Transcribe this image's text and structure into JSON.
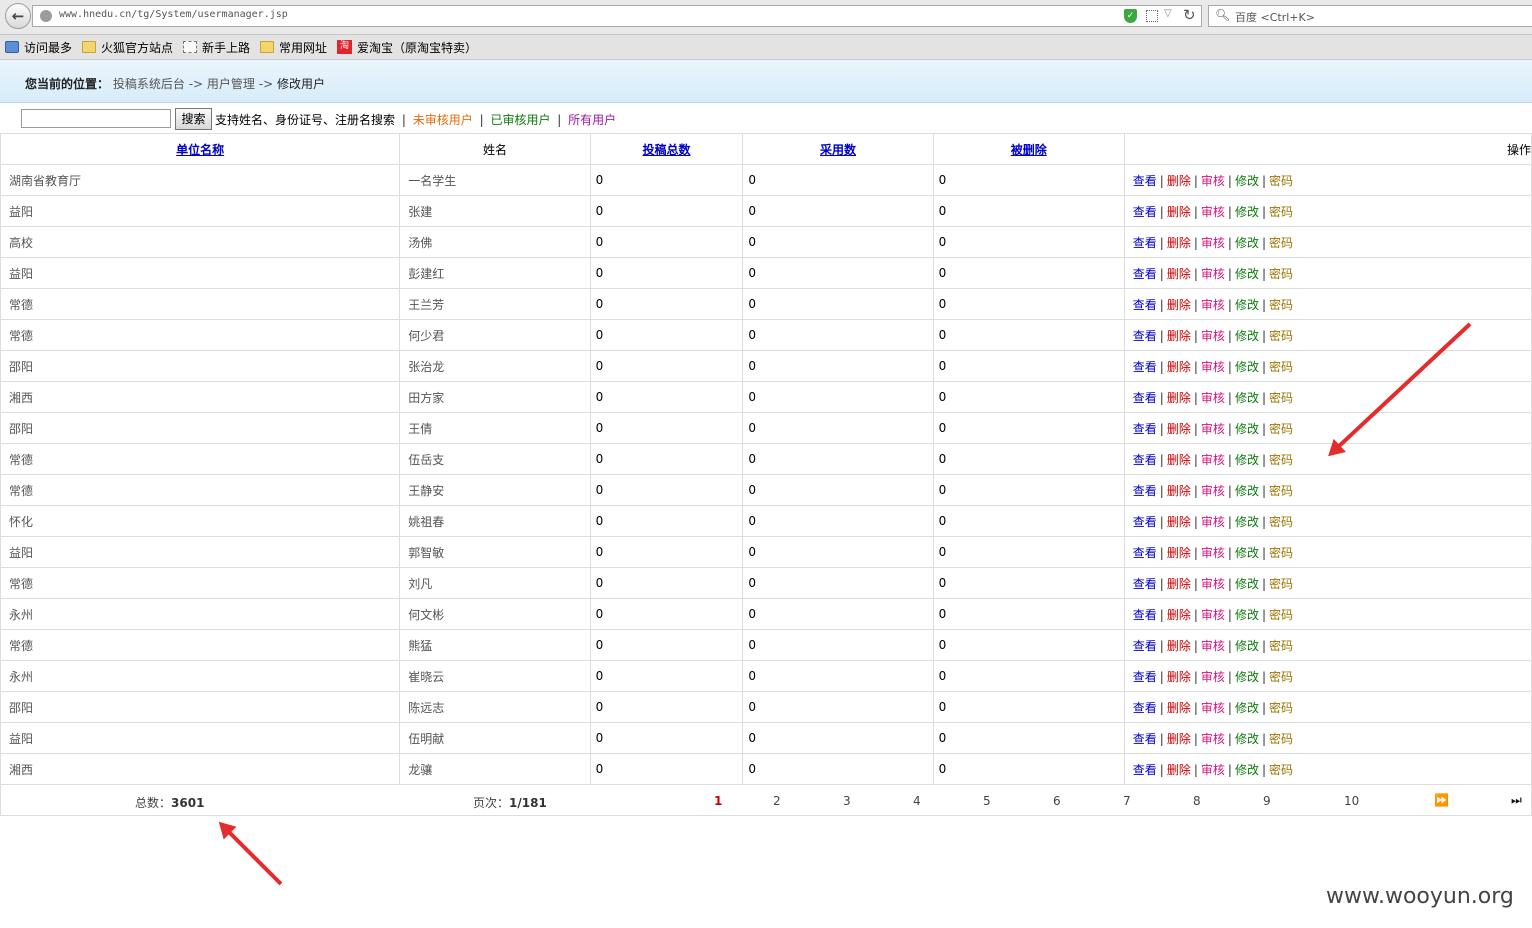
{
  "browser": {
    "url": "www.hnedu.cn/tg/System/usermanager.jsp",
    "search_placeholder": "百度 <Ctrl+K>",
    "bookmarks": [
      {
        "label": "访问最多",
        "icon": "visited-icon"
      },
      {
        "label": "火狐官方站点",
        "icon": "folder-icon"
      },
      {
        "label": "新手上路",
        "icon": "page-icon"
      },
      {
        "label": "常用网址",
        "icon": "folder-icon"
      },
      {
        "label": "爱淘宝（原淘宝特卖）",
        "icon": "taobao-icon",
        "icon_text": "淘"
      }
    ]
  },
  "breadcrumb": {
    "label": "您当前的位置：",
    "items": [
      "投稿系统后台",
      "用户管理",
      "修改用户"
    ],
    "separator": "->"
  },
  "search": {
    "button": "搜索",
    "hint": "支持姓名、身份证号、注册名搜索",
    "filter_unreviewed": "未审核用户",
    "filter_reviewed": "已审核用户",
    "filter_all": "所有用户"
  },
  "table": {
    "headers": [
      "单位名称",
      "姓名",
      "投稿总数",
      "采用数",
      "被删除",
      "操作"
    ],
    "actions": [
      "查看",
      "删除",
      "审核",
      "修改",
      "密码"
    ],
    "rows": [
      [
        "湖南省教育厅",
        "一名学生",
        "0",
        "0",
        "0"
      ],
      [
        "益阳",
        "张建",
        "0",
        "0",
        "0"
      ],
      [
        "高校",
        "汤佛",
        "0",
        "0",
        "0"
      ],
      [
        "益阳",
        "彭建红",
        "0",
        "0",
        "0"
      ],
      [
        "常德",
        "王兰芳",
        "0",
        "0",
        "0"
      ],
      [
        "常德",
        "何少君",
        "0",
        "0",
        "0"
      ],
      [
        "邵阳",
        "张治龙",
        "0",
        "0",
        "0"
      ],
      [
        "湘西",
        "田方家",
        "0",
        "0",
        "0"
      ],
      [
        "邵阳",
        "王倩",
        "0",
        "0",
        "0"
      ],
      [
        "常德",
        "伍岳支",
        "0",
        "0",
        "0"
      ],
      [
        "常德",
        "王静安",
        "0",
        "0",
        "0"
      ],
      [
        "怀化",
        "姚祖春",
        "0",
        "0",
        "0"
      ],
      [
        "益阳",
        "郭智敏",
        "0",
        "0",
        "0"
      ],
      [
        "常德",
        "刘凡",
        "0",
        "0",
        "0"
      ],
      [
        "永州",
        "何文彬",
        "0",
        "0",
        "0"
      ],
      [
        "常德",
        "熊猛",
        "0",
        "0",
        "0"
      ],
      [
        "永州",
        "崔晓云",
        "0",
        "0",
        "0"
      ],
      [
        "邵阳",
        "陈远志",
        "0",
        "0",
        "0"
      ],
      [
        "益阳",
        "伍明献",
        "0",
        "0",
        "0"
      ],
      [
        "湘西",
        "龙骧",
        "0",
        "0",
        "0"
      ]
    ]
  },
  "pagination": {
    "total_label": "总数：",
    "total": "3601",
    "page_label": "页次：",
    "page": "1/181",
    "current": "1",
    "pages": [
      "1",
      "2",
      "3",
      "4",
      "5",
      "6",
      "7",
      "8",
      "9",
      "10"
    ],
    "next_glyph": "⏩",
    "last_glyph": "⏭"
  },
  "watermark": "www.wooyun.org",
  "colors": {
    "annotation_arrow": "#e42c2c",
    "link_blue": "#0000cc",
    "delete_red": "#cc0000",
    "audit_pink": "#d6137f",
    "edit_green": "#0d7a0d",
    "password_gold": "#9a7300"
  }
}
